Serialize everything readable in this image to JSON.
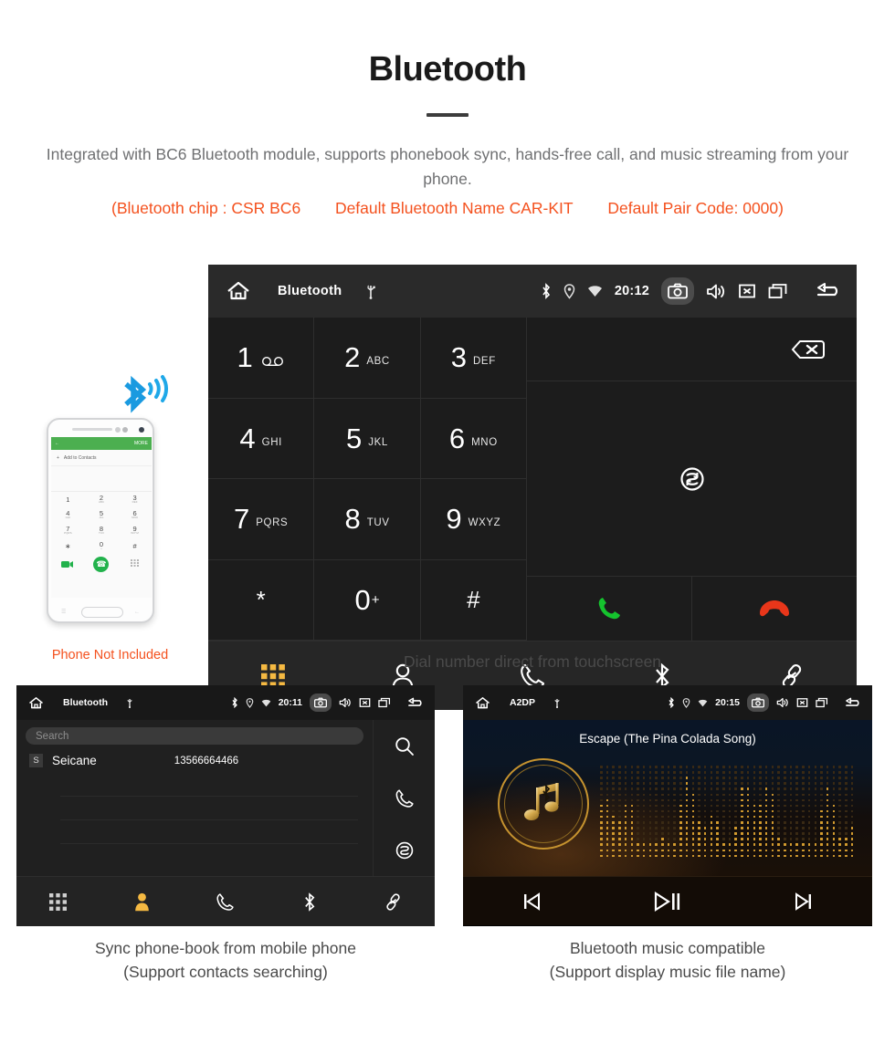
{
  "header": {
    "title": "Bluetooth",
    "description": "Integrated with BC6 Bluetooth module, supports phonebook sync, hands-free call, and music streaming from your phone.",
    "chip_info": "(Bluetooth chip : CSR BC6",
    "bt_name": "Default Bluetooth Name CAR-KIT",
    "pair_code": "Default Pair Code: 0000)",
    "accent_color": "#f4511e",
    "text_color": "#6f7072"
  },
  "dialer": {
    "statusbar": {
      "title": "Bluetooth",
      "time": "20:12",
      "icons": [
        "home-icon",
        "usb-icon",
        "bluetooth-icon",
        "location-icon",
        "wifi-icon",
        "camera-icon",
        "volume-icon",
        "mute-icon",
        "recents-icon",
        "back-icon"
      ]
    },
    "keys": [
      {
        "num": "1",
        "sub": "",
        "voicemail": true
      },
      {
        "num": "2",
        "sub": "ABC"
      },
      {
        "num": "3",
        "sub": "DEF"
      },
      {
        "num": "4",
        "sub": "GHI"
      },
      {
        "num": "5",
        "sub": "JKL"
      },
      {
        "num": "6",
        "sub": "MNO"
      },
      {
        "num": "7",
        "sub": "PQRS"
      },
      {
        "num": "8",
        "sub": "TUV"
      },
      {
        "num": "9",
        "sub": "WXYZ"
      },
      {
        "num": "*",
        "sub": ""
      },
      {
        "num": "0",
        "sub": "",
        "sup": "+"
      },
      {
        "num": "#",
        "sub": ""
      }
    ],
    "side_actions": [
      "backspace-icon",
      "sync-icon",
      "call-icon",
      "endcall-icon"
    ],
    "call_color": "#15c32e",
    "endcall_color": "#e8361a",
    "nav": [
      "keypad-icon",
      "contacts-icon",
      "calls-icon",
      "bluetooth-icon",
      "link-icon"
    ],
    "nav_active": "keypad-icon",
    "nav_active_color": "#f5b942",
    "caption": "Dial number direct from touchscreen"
  },
  "phone_mockup": {
    "header_back": "←",
    "header_more": "MORE",
    "add_contacts": "Add to Contacts",
    "keys": [
      {
        "n": "1",
        "s": ""
      },
      {
        "n": "2",
        "s": "ABC"
      },
      {
        "n": "3",
        "s": "DEF"
      },
      {
        "n": "4",
        "s": "GHI"
      },
      {
        "n": "5",
        "s": "JKL"
      },
      {
        "n": "6",
        "s": "MNO"
      },
      {
        "n": "7",
        "s": "PQRS"
      },
      {
        "n": "8",
        "s": "TUV"
      },
      {
        "n": "9",
        "s": "WXYZ"
      },
      {
        "n": "∗",
        "s": ""
      },
      {
        "n": "0",
        "s": "+"
      },
      {
        "n": "#",
        "s": ""
      }
    ],
    "not_included": "Phone Not Included",
    "not_included_color": "#f4511e",
    "bluetooth_logo_color": "#1a9ae0"
  },
  "phonebook": {
    "statusbar": {
      "title": "Bluetooth",
      "time": "20:11"
    },
    "search_placeholder": "Search",
    "contacts": [
      {
        "letter": "S",
        "name": "Seicane",
        "number": "13566664466"
      }
    ],
    "side_actions": [
      "search-icon",
      "call-icon",
      "sync-icon"
    ],
    "nav": [
      "keypad-icon",
      "contacts-icon",
      "calls-icon",
      "bluetooth-icon",
      "link-icon"
    ],
    "nav_active": "contacts-icon",
    "caption_line1": "Sync phone-book from mobile phone",
    "caption_line2": "(Support contacts searching)"
  },
  "music": {
    "statusbar": {
      "title": "A2DP",
      "time": "20:15"
    },
    "song_title": "Escape (The Pina Colada Song)",
    "controls": [
      "previous-icon",
      "play-pause-icon",
      "next-icon"
    ],
    "accent_color": "#c6932f",
    "caption_line1": "Bluetooth music compatible",
    "caption_line2": "(Support display music file name)"
  }
}
